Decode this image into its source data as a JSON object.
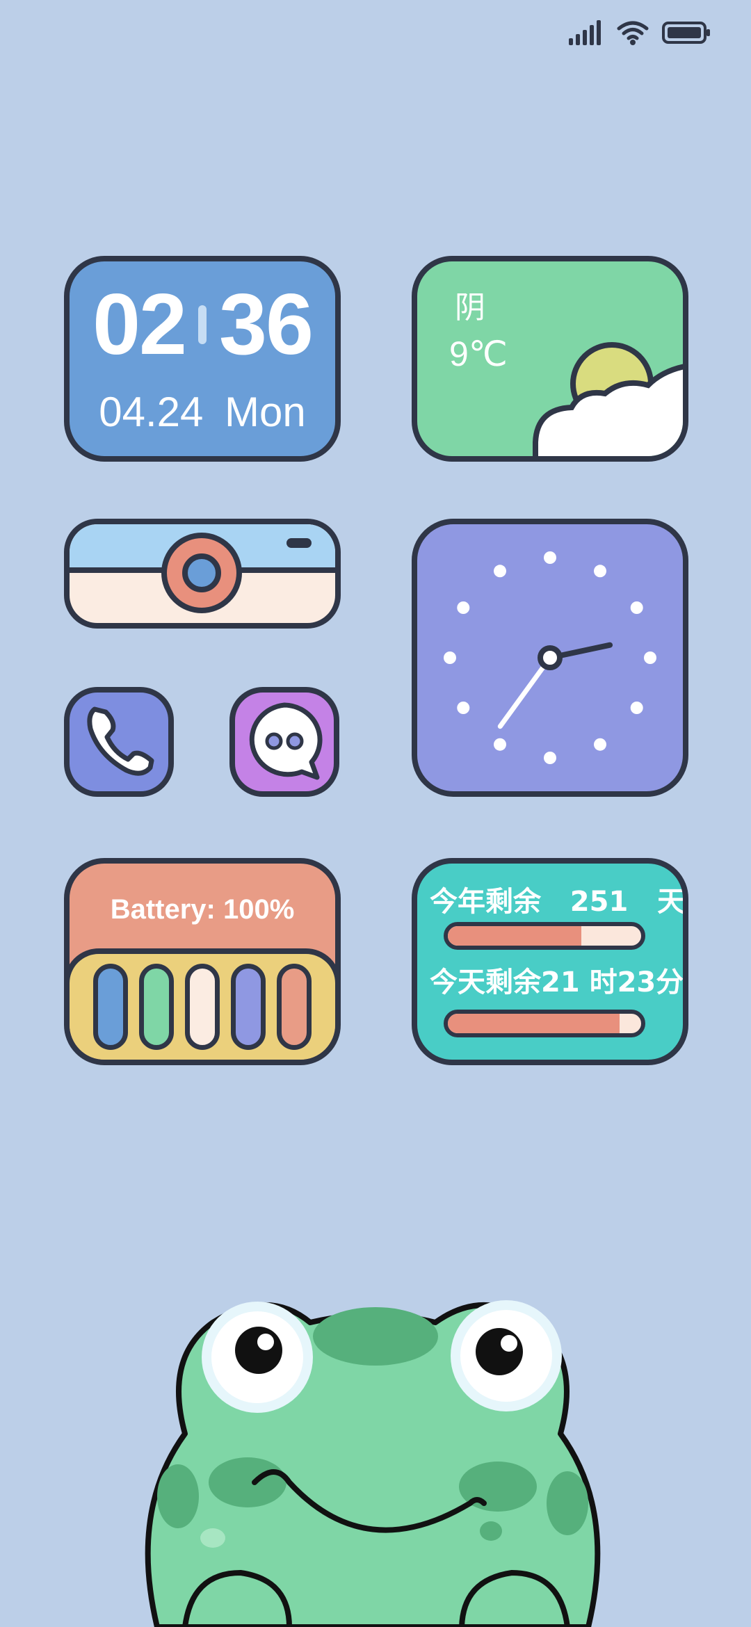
{
  "status_bar": {
    "icons": [
      "cellular-signal-icon",
      "wifi-icon",
      "battery-icon"
    ]
  },
  "clock_widget": {
    "hour": "02",
    "minute": "36",
    "date": "04.24",
    "weekday": "Mon"
  },
  "weather_widget": {
    "condition": "阴",
    "temperature": "9℃",
    "icon": "sun-behind-cloud-icon"
  },
  "camera_widget": {
    "icon": "camera-icon"
  },
  "phone_widget": {
    "icon": "phone-icon"
  },
  "message_widget": {
    "icon": "chat-bubble-icon"
  },
  "analog_clock": {
    "hour": 2,
    "minute": 36
  },
  "battery_widget": {
    "label": "Battery: 100%",
    "level": 1.0,
    "pill_colors": [
      "#6a9ed8",
      "#7fd6a6",
      "#fbece2",
      "#8f98e2",
      "#e89c86"
    ]
  },
  "countdown_widget": {
    "year_label": "今年剩余",
    "year_value": "251",
    "year_unit": "天",
    "year_remaining_fraction": 0.69,
    "today_label": "今天剩余21 时23分",
    "today_remaining_fraction": 0.89
  },
  "wallpaper": {
    "character": "frog-illustration"
  },
  "colors": {
    "background": "#bccfe8",
    "outline": "#2f3647",
    "accent_blue": "#6a9ed8",
    "accent_green": "#7fd6a6",
    "accent_purple": "#8f98e2",
    "accent_salmon": "#e89c86",
    "accent_teal": "#49cdc6"
  }
}
